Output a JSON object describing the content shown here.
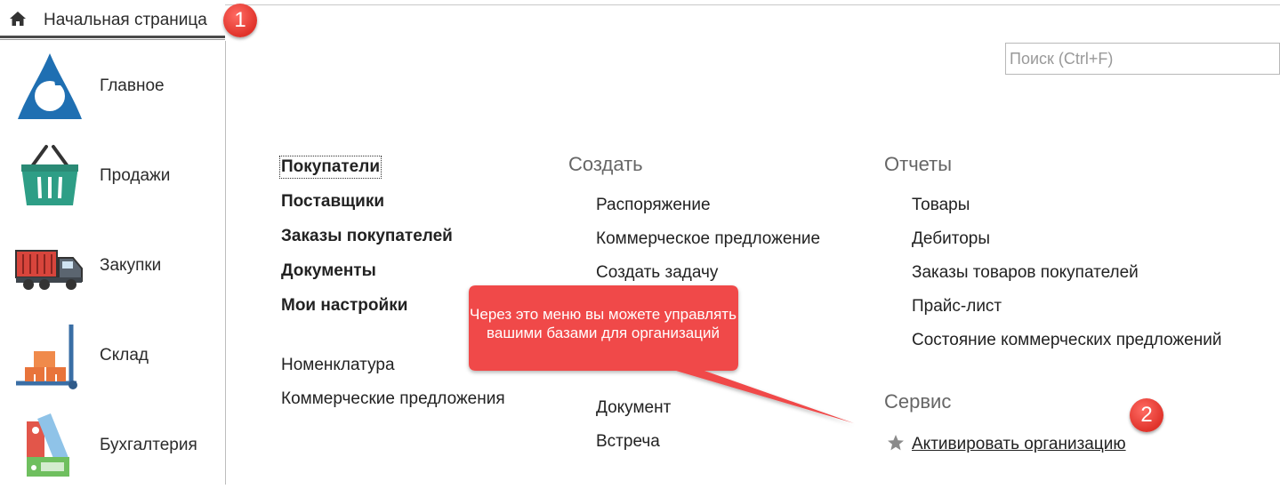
{
  "tab": {
    "label": "Начальная страница"
  },
  "badges": {
    "one": "1",
    "two": "2"
  },
  "sidebar": {
    "items": [
      {
        "label": "Главное",
        "icon": "triangle-logo-icon"
      },
      {
        "label": "Продажи",
        "icon": "shopping-basket-icon"
      },
      {
        "label": "Закупки",
        "icon": "truck-icon"
      },
      {
        "label": "Склад",
        "icon": "hand-truck-boxes-icon"
      },
      {
        "label": "Бухгалтерия",
        "icon": "binders-icon"
      }
    ]
  },
  "search": {
    "placeholder": "Поиск (Ctrl+F)"
  },
  "col1": {
    "bold_links": [
      "Покупатели",
      "Поставщики",
      "Заказы покупателей",
      "Документы",
      "Мои настройки"
    ],
    "links": [
      "Номенклатура",
      "Коммерческие предложения"
    ]
  },
  "col2": {
    "heading": "Создать",
    "links": [
      "Распоряжение",
      "Коммерческое предложение",
      "Создать задачу",
      "Документ",
      "Встреча"
    ]
  },
  "col3": {
    "heading": "Отчеты",
    "links": [
      "Товары",
      "Дебиторы",
      "Заказы товаров покупателей",
      "Прайс-лист",
      "Состояние коммерческих предложений"
    ],
    "service_heading": "Сервис",
    "service_link": "Активировать организацию"
  },
  "callout": {
    "text": "Через это меню вы можете управлять вашими базами для организаций"
  },
  "colors": {
    "accent_red": "#f04848",
    "heading_gray": "#666666",
    "logo_blue": "#1f6fb2",
    "basket_green": "#2e9e86"
  }
}
